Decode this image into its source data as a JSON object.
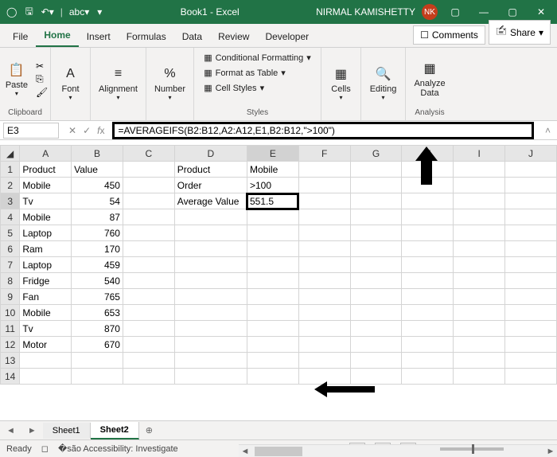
{
  "titlebar": {
    "title": "Book1 - Excel",
    "user": "NIRMAL KAMISHETTY",
    "avatar": "NK"
  },
  "tabs": {
    "file": "File",
    "home": "Home",
    "insert": "Insert",
    "formulas": "Formulas",
    "data": "Data",
    "review": "Review",
    "developer": "Developer",
    "comments": "Comments",
    "share": "Share"
  },
  "ribbon": {
    "paste": "Paste",
    "clipboard": "Clipboard",
    "font": "Font",
    "alignment": "Alignment",
    "number": "Number",
    "cond_fmt": "Conditional Formatting",
    "as_table": "Format as Table",
    "cell_styles": "Cell Styles",
    "styles": "Styles",
    "cells": "Cells",
    "editing": "Editing",
    "analyze": "Analyze",
    "analyze2": "Data",
    "analysis": "Analysis"
  },
  "namebox": "E3",
  "formula": "=AVERAGEIFS(B2:B12,A2:A12,E1,B2:B12,\">100\")",
  "cols": [
    "A",
    "B",
    "C",
    "D",
    "E",
    "F",
    "G",
    "H",
    "I",
    "J"
  ],
  "sheet": {
    "headers": {
      "product": "Product",
      "value": "Value",
      "product2": "Product",
      "mobile": "Mobile",
      "order": "Order",
      "gt100": ">100",
      "avg": "Average Value",
      "avgval": "551.5"
    },
    "rows": [
      {
        "a": "Mobile",
        "b": "450"
      },
      {
        "a": "Tv",
        "b": "54"
      },
      {
        "a": "Mobile",
        "b": "87"
      },
      {
        "a": "Laptop",
        "b": "760"
      },
      {
        "a": "Ram",
        "b": "170"
      },
      {
        "a": "Laptop",
        "b": "459"
      },
      {
        "a": "Fridge",
        "b": "540"
      },
      {
        "a": "Fan",
        "b": "765"
      },
      {
        "a": "Mobile",
        "b": "653"
      },
      {
        "a": "Tv",
        "b": "870"
      },
      {
        "a": "Motor",
        "b": "670"
      }
    ]
  },
  "sheettabs": {
    "s1": "Sheet1",
    "s2": "Sheet2"
  },
  "status": {
    "ready": "Ready",
    "access": "Accessibility: Investigate",
    "zoom": "100%"
  }
}
